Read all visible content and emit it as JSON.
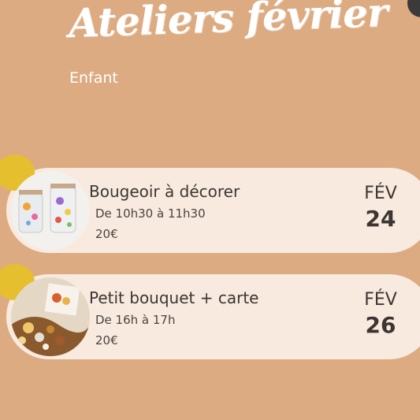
{
  "header": {
    "title": "Ateliers février",
    "subtitle": "Enfant"
  },
  "events": [
    {
      "title": "Bougeoir à décorer",
      "time": "De 10h30 à 11h30",
      "price": "20€",
      "month": "FÉV",
      "day": "24"
    },
    {
      "title": "Petit bouquet + carte",
      "time": "De 16h à 17h",
      "price": "20€",
      "month": "FÉV",
      "day": "26"
    }
  ],
  "colors": {
    "background": "#dcab82",
    "card": "#f8eadf",
    "accent_blob": "#e5bf2e",
    "text": "#3c3632"
  }
}
